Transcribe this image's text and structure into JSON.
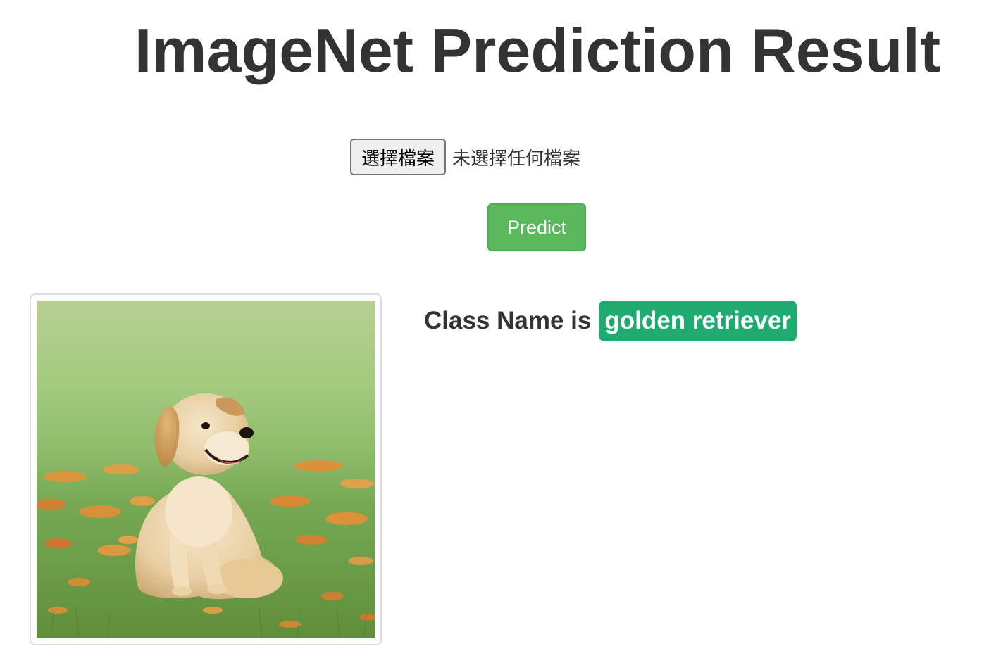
{
  "header": {
    "title": "ImageNet Prediction Result"
  },
  "upload": {
    "choose_file_label": "選擇檔案",
    "file_status": "未選擇任何檔案"
  },
  "actions": {
    "predict_label": "Predict"
  },
  "preview": {
    "subject": "golden retriever puppy sitting on grass with orange flowers",
    "icon": "photo-image"
  },
  "result": {
    "label": "Class Name is",
    "class_name": "golden retriever"
  },
  "colors": {
    "predict_button": "#5cb85c",
    "result_badge": "#1fab6f",
    "text": "#333333"
  }
}
